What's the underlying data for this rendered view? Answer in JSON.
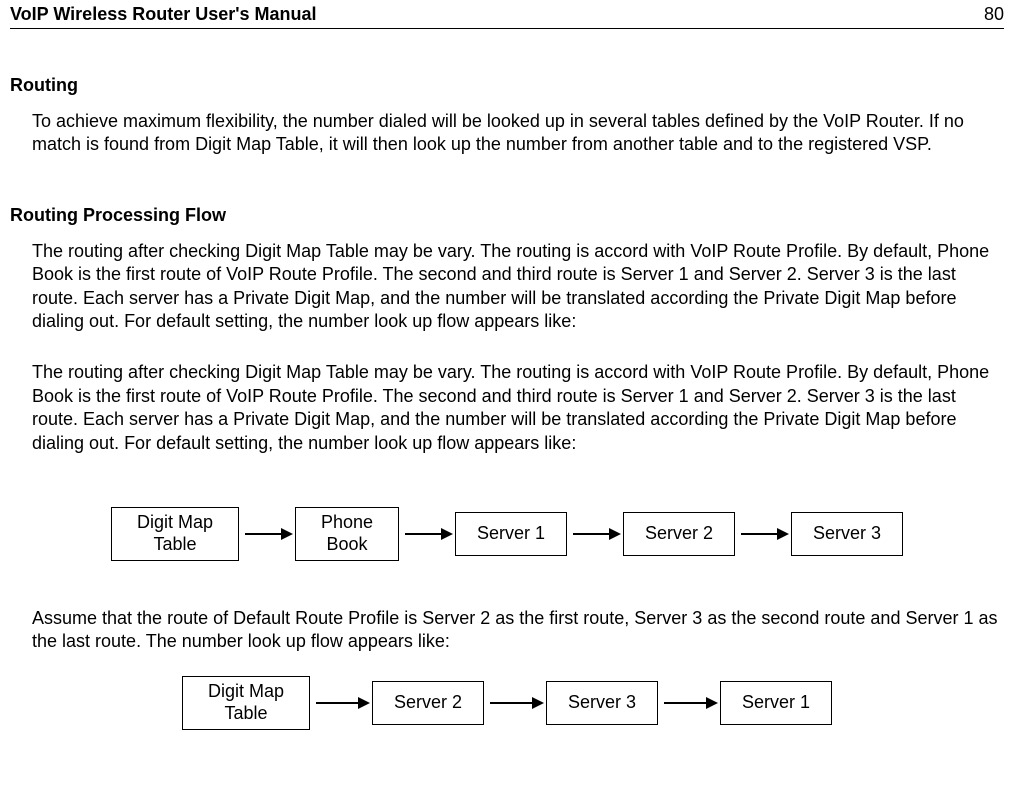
{
  "header": {
    "title": "VoIP Wireless Router User's Manual",
    "page_number": "80"
  },
  "sections": {
    "routing": {
      "heading": "Routing",
      "p1": "To achieve maximum flexibility, the number dialed will be looked up in several tables defined by the VoIP Router. If no match is found from Digit Map Table, it will then look up the number from another table and to the registered VSP."
    },
    "processing_flow": {
      "heading": "Routing Processing Flow",
      "p1": "The routing after checking Digit Map Table may be vary. The routing is accord with VoIP Route Profile. By default, Phone Book is the first route of VoIP Route Profile. The second and third route is Server 1 and Server 2. Server 3 is the last route. Each server has a Private Digit Map, and the number will be translated according the Private Digit Map before dialing out. For default setting, the number look up flow appears like:",
      "p2": "The routing after checking Digit Map Table may be vary. The routing is accord with VoIP Route Profile. By default, Phone Book is the first route of VoIP Route Profile. The second and third route is Server 1 and Server 2. Server 3 is the last route. Each server has a Private Digit Map, and the number will be translated according the Private Digit Map before dialing out. For default setting, the number look up flow appears like:",
      "p3": "Assume that the route of Default Route Profile is Server 2 as the first route, Server 3 as the second route and Server 1 as the last route. The number look up flow appears like:"
    }
  },
  "diagram1": {
    "n1a": "Digit Map",
    "n1b": "Table",
    "n2a": "Phone",
    "n2b": "Book",
    "n3": "Server 1",
    "n4": "Server 2",
    "n5": "Server 3"
  },
  "diagram2": {
    "n1a": "Digit Map",
    "n1b": "Table",
    "n2": "Server 2",
    "n3": "Server 3",
    "n4": "Server 1"
  },
  "chart_data": [
    {
      "type": "diagram",
      "title": "Default routing flow",
      "nodes": [
        "Digit Map Table",
        "Phone Book",
        "Server 1",
        "Server 2",
        "Server 3"
      ],
      "edges": [
        [
          "Digit Map Table",
          "Phone Book"
        ],
        [
          "Phone Book",
          "Server 1"
        ],
        [
          "Server 1",
          "Server 2"
        ],
        [
          "Server 2",
          "Server 3"
        ]
      ]
    },
    {
      "type": "diagram",
      "title": "Default Route Profile: Server 2, Server 3, Server 1",
      "nodes": [
        "Digit Map Table",
        "Server 2",
        "Server 3",
        "Server 1"
      ],
      "edges": [
        [
          "Digit Map Table",
          "Server 2"
        ],
        [
          "Server 2",
          "Server 3"
        ],
        [
          "Server 3",
          "Server 1"
        ]
      ]
    }
  ]
}
